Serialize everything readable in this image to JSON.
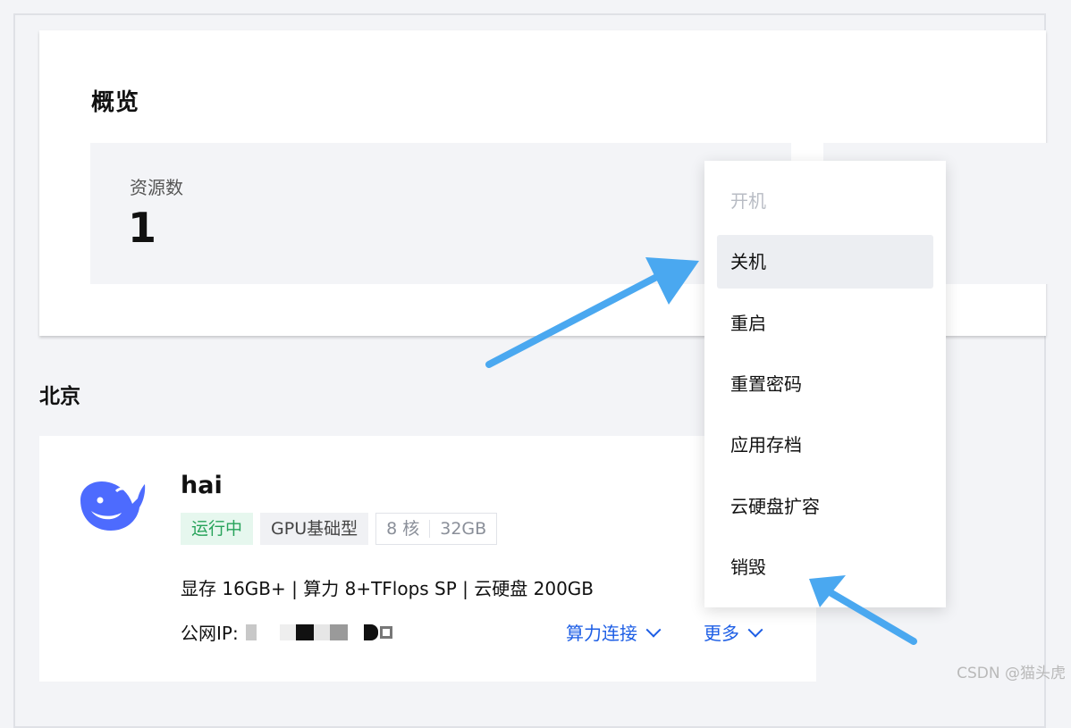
{
  "overview": {
    "title": "概览",
    "stat_label": "资源数",
    "stat_value": "1"
  },
  "region": {
    "title": "北京"
  },
  "instance": {
    "name": "hai",
    "status": "运行中",
    "type": "GPU基础型",
    "cores": "8 核",
    "memory": "32GB",
    "specs": "显存 16GB+ | 算力 8+TFlops SP | 云硬盘 200GB",
    "ip_label": "公网IP:",
    "action_connect": "算力连接",
    "action_more": "更多"
  },
  "dropdown": {
    "items": [
      {
        "label": "开机",
        "state": "disabled"
      },
      {
        "label": "关机",
        "state": "active"
      },
      {
        "label": "重启",
        "state": "normal"
      },
      {
        "label": "重置密码",
        "state": "normal"
      },
      {
        "label": "应用存档",
        "state": "normal"
      },
      {
        "label": "云硬盘扩容",
        "state": "normal"
      },
      {
        "label": "销毁",
        "state": "normal"
      }
    ]
  },
  "watermark": "CSDN @猫头虎",
  "colors": {
    "accent": "#1d5ee5",
    "running": "#27a35a",
    "arrow": "#4aa8f0",
    "logo": "#4d6bfe"
  },
  "icons": {
    "logo": "deepseek-whale-icon",
    "chevron": "chevron-down-icon"
  }
}
